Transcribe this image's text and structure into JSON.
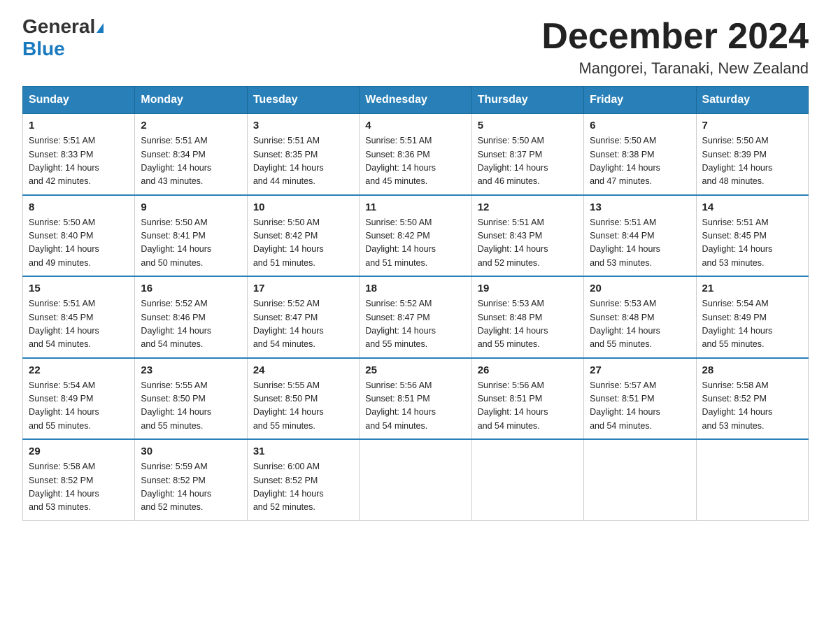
{
  "logo": {
    "text1": "General",
    "text2": "Blue"
  },
  "header": {
    "title": "December 2024",
    "location": "Mangorei, Taranaki, New Zealand"
  },
  "days_of_week": [
    "Sunday",
    "Monday",
    "Tuesday",
    "Wednesday",
    "Thursday",
    "Friday",
    "Saturday"
  ],
  "weeks": [
    [
      {
        "day": "1",
        "sunrise": "5:51 AM",
        "sunset": "8:33 PM",
        "daylight": "14 hours and 42 minutes."
      },
      {
        "day": "2",
        "sunrise": "5:51 AM",
        "sunset": "8:34 PM",
        "daylight": "14 hours and 43 minutes."
      },
      {
        "day": "3",
        "sunrise": "5:51 AM",
        "sunset": "8:35 PM",
        "daylight": "14 hours and 44 minutes."
      },
      {
        "day": "4",
        "sunrise": "5:51 AM",
        "sunset": "8:36 PM",
        "daylight": "14 hours and 45 minutes."
      },
      {
        "day": "5",
        "sunrise": "5:50 AM",
        "sunset": "8:37 PM",
        "daylight": "14 hours and 46 minutes."
      },
      {
        "day": "6",
        "sunrise": "5:50 AM",
        "sunset": "8:38 PM",
        "daylight": "14 hours and 47 minutes."
      },
      {
        "day": "7",
        "sunrise": "5:50 AM",
        "sunset": "8:39 PM",
        "daylight": "14 hours and 48 minutes."
      }
    ],
    [
      {
        "day": "8",
        "sunrise": "5:50 AM",
        "sunset": "8:40 PM",
        "daylight": "14 hours and 49 minutes."
      },
      {
        "day": "9",
        "sunrise": "5:50 AM",
        "sunset": "8:41 PM",
        "daylight": "14 hours and 50 minutes."
      },
      {
        "day": "10",
        "sunrise": "5:50 AM",
        "sunset": "8:42 PM",
        "daylight": "14 hours and 51 minutes."
      },
      {
        "day": "11",
        "sunrise": "5:50 AM",
        "sunset": "8:42 PM",
        "daylight": "14 hours and 51 minutes."
      },
      {
        "day": "12",
        "sunrise": "5:51 AM",
        "sunset": "8:43 PM",
        "daylight": "14 hours and 52 minutes."
      },
      {
        "day": "13",
        "sunrise": "5:51 AM",
        "sunset": "8:44 PM",
        "daylight": "14 hours and 53 minutes."
      },
      {
        "day": "14",
        "sunrise": "5:51 AM",
        "sunset": "8:45 PM",
        "daylight": "14 hours and 53 minutes."
      }
    ],
    [
      {
        "day": "15",
        "sunrise": "5:51 AM",
        "sunset": "8:45 PM",
        "daylight": "14 hours and 54 minutes."
      },
      {
        "day": "16",
        "sunrise": "5:52 AM",
        "sunset": "8:46 PM",
        "daylight": "14 hours and 54 minutes."
      },
      {
        "day": "17",
        "sunrise": "5:52 AM",
        "sunset": "8:47 PM",
        "daylight": "14 hours and 54 minutes."
      },
      {
        "day": "18",
        "sunrise": "5:52 AM",
        "sunset": "8:47 PM",
        "daylight": "14 hours and 55 minutes."
      },
      {
        "day": "19",
        "sunrise": "5:53 AM",
        "sunset": "8:48 PM",
        "daylight": "14 hours and 55 minutes."
      },
      {
        "day": "20",
        "sunrise": "5:53 AM",
        "sunset": "8:48 PM",
        "daylight": "14 hours and 55 minutes."
      },
      {
        "day": "21",
        "sunrise": "5:54 AM",
        "sunset": "8:49 PM",
        "daylight": "14 hours and 55 minutes."
      }
    ],
    [
      {
        "day": "22",
        "sunrise": "5:54 AM",
        "sunset": "8:49 PM",
        "daylight": "14 hours and 55 minutes."
      },
      {
        "day": "23",
        "sunrise": "5:55 AM",
        "sunset": "8:50 PM",
        "daylight": "14 hours and 55 minutes."
      },
      {
        "day": "24",
        "sunrise": "5:55 AM",
        "sunset": "8:50 PM",
        "daylight": "14 hours and 55 minutes."
      },
      {
        "day": "25",
        "sunrise": "5:56 AM",
        "sunset": "8:51 PM",
        "daylight": "14 hours and 54 minutes."
      },
      {
        "day": "26",
        "sunrise": "5:56 AM",
        "sunset": "8:51 PM",
        "daylight": "14 hours and 54 minutes."
      },
      {
        "day": "27",
        "sunrise": "5:57 AM",
        "sunset": "8:51 PM",
        "daylight": "14 hours and 54 minutes."
      },
      {
        "day": "28",
        "sunrise": "5:58 AM",
        "sunset": "8:52 PM",
        "daylight": "14 hours and 53 minutes."
      }
    ],
    [
      {
        "day": "29",
        "sunrise": "5:58 AM",
        "sunset": "8:52 PM",
        "daylight": "14 hours and 53 minutes."
      },
      {
        "day": "30",
        "sunrise": "5:59 AM",
        "sunset": "8:52 PM",
        "daylight": "14 hours and 52 minutes."
      },
      {
        "day": "31",
        "sunrise": "6:00 AM",
        "sunset": "8:52 PM",
        "daylight": "14 hours and 52 minutes."
      },
      null,
      null,
      null,
      null
    ]
  ],
  "labels": {
    "sunrise": "Sunrise:",
    "sunset": "Sunset:",
    "daylight": "Daylight:"
  }
}
